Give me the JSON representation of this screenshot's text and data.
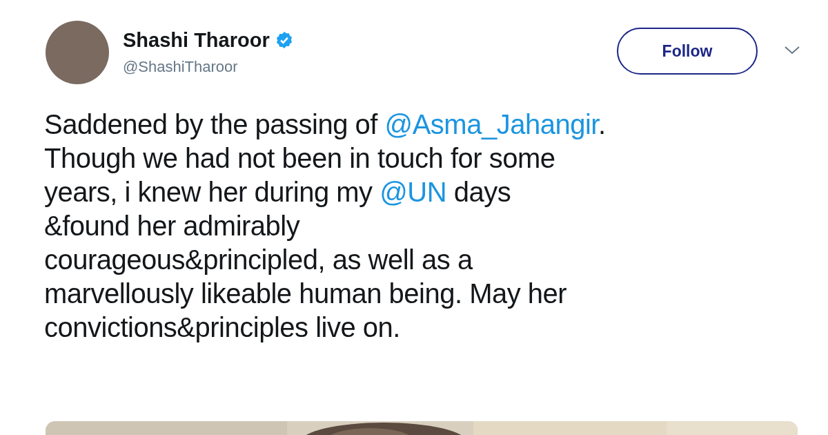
{
  "author": {
    "name": "Shashi Tharoor",
    "verified": true,
    "handle": "@ShashiTharoor"
  },
  "follow_button": "Follow",
  "tweet_lines": [
    [
      {
        "kind": "text",
        "text": "Saddened by the passing of "
      },
      {
        "kind": "mention",
        "text": "@Asma_Jahangir"
      },
      {
        "kind": "text",
        "text": "."
      }
    ],
    [
      {
        "kind": "text",
        "text": "Though we had not been in touch for some"
      }
    ],
    [
      {
        "kind": "text",
        "text": "years, i knew her during my "
      },
      {
        "kind": "mention",
        "text": "@UN"
      },
      {
        "kind": "text",
        "text": " days"
      }
    ],
    [
      {
        "kind": "text",
        "text": "&found her admirably"
      }
    ],
    [
      {
        "kind": "text",
        "text": "courageous&principled, as well as a"
      }
    ],
    [
      {
        "kind": "text",
        "text": "marvellously likeable human being. May her"
      }
    ],
    [
      {
        "kind": "text",
        "text": "convictions&principles live on."
      }
    ]
  ]
}
